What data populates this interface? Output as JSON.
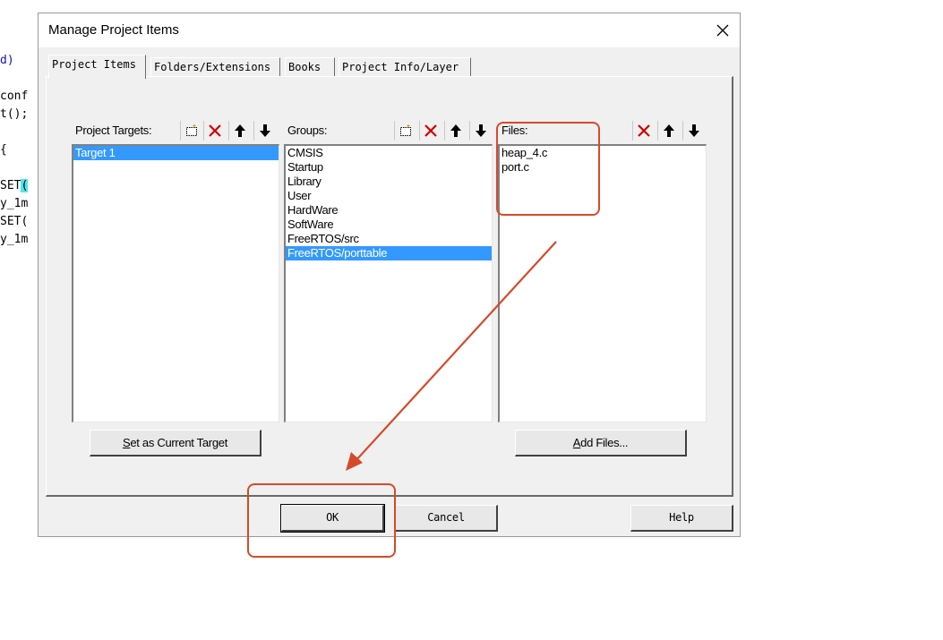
{
  "background_code": {
    "lines": [
      {
        "text": "d)",
        "highlight": ""
      },
      {
        "text": "conf",
        "highlight": ""
      },
      {
        "text": "t();",
        "highlight": ""
      },
      {
        "text": "{",
        "highlight": ""
      },
      {
        "text": "SET",
        "highlight": "("
      },
      {
        "text": "y_1m",
        "highlight": ""
      },
      {
        "text": "SET(",
        "highlight": ""
      },
      {
        "text": "y_1m",
        "highlight": ""
      }
    ]
  },
  "dialog": {
    "title": "Manage Project Items",
    "close_icon": "close-icon",
    "tabs": [
      {
        "label": "Project Items",
        "active": true
      },
      {
        "label": "Folders/Extensions",
        "active": false
      },
      {
        "label": "Books",
        "active": false
      },
      {
        "label": "Project Info/Layer",
        "active": false
      }
    ],
    "targets": {
      "label": "Project Targets:",
      "toolbar": [
        "new-icon",
        "delete-icon",
        "move-up-icon",
        "move-down-icon"
      ],
      "items": [
        {
          "text": "Target 1",
          "selected": true
        }
      ],
      "button": "Set as Current Target",
      "button_hotkey": "S"
    },
    "groups": {
      "label": "Groups:",
      "toolbar": [
        "new-icon",
        "delete-icon",
        "move-up-icon",
        "move-down-icon"
      ],
      "items": [
        {
          "text": "CMSIS",
          "selected": false
        },
        {
          "text": "Startup",
          "selected": false
        },
        {
          "text": "Library",
          "selected": false
        },
        {
          "text": "User",
          "selected": false
        },
        {
          "text": "HardWare",
          "selected": false
        },
        {
          "text": "SoftWare",
          "selected": false
        },
        {
          "text": "FreeRTOS/src",
          "selected": false
        },
        {
          "text": "FreeRTOS/porttable",
          "selected": true
        }
      ]
    },
    "files": {
      "label": "Files:",
      "toolbar": [
        "delete-icon",
        "move-up-icon",
        "move-down-icon"
      ],
      "items": [
        {
          "text": "heap_4.c",
          "selected": false
        },
        {
          "text": "port.c",
          "selected": false
        }
      ],
      "button": "Add Files...",
      "button_hotkey": "A"
    },
    "footer": {
      "ok": "OK",
      "cancel": "Cancel",
      "help": "Help"
    }
  },
  "colors": {
    "annotation_red": "#d64a2a",
    "selection_blue": "#3399ff",
    "dialog_bg": "#f0f0f0"
  }
}
